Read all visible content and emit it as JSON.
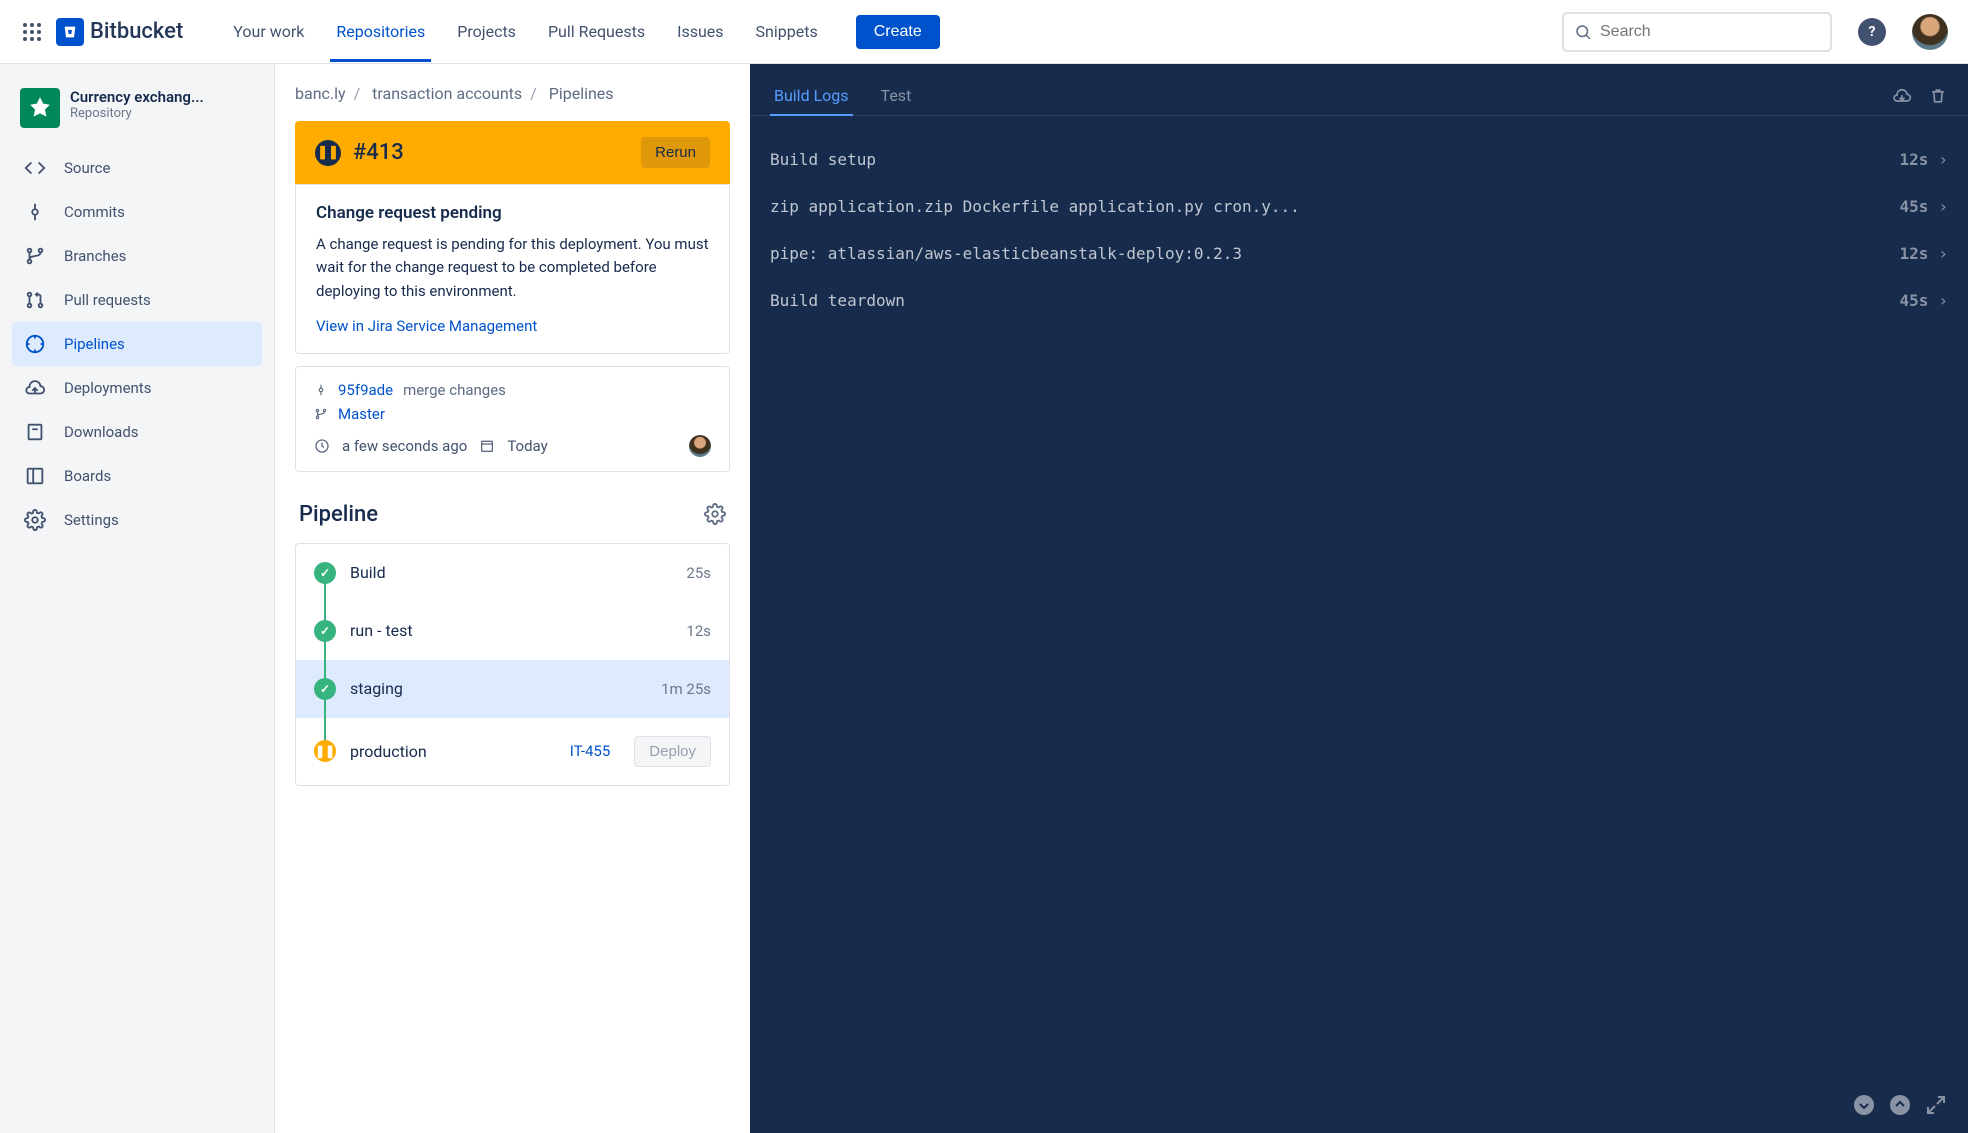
{
  "topbar": {
    "product": "Bitbucket",
    "links": [
      "Your work",
      "Repositories",
      "Projects",
      "Pull Requests",
      "Issues",
      "Snippets"
    ],
    "active_link_index": 1,
    "create": "Create",
    "search_placeholder": "Search"
  },
  "sidebar": {
    "repo_name": "Currency exchang...",
    "repo_sub": "Repository",
    "items": [
      {
        "label": "Source"
      },
      {
        "label": "Commits"
      },
      {
        "label": "Branches"
      },
      {
        "label": "Pull requests"
      },
      {
        "label": "Pipelines"
      },
      {
        "label": "Deployments"
      },
      {
        "label": "Downloads"
      },
      {
        "label": "Boards"
      },
      {
        "label": "Settings"
      }
    ],
    "active_index": 4
  },
  "breadcrumb": [
    "banc.ly",
    "transaction accounts",
    "Pipelines"
  ],
  "run": {
    "number": "#413",
    "rerun": "Rerun"
  },
  "notice": {
    "title": "Change request pending",
    "body": "A change request is pending for this deployment. You must wait for the change request to be completed before deploying to this environment.",
    "link": "View in Jira Service Management"
  },
  "commit": {
    "hash": "95f9ade",
    "message": "merge changes",
    "branch": "Master",
    "age": "a few seconds ago",
    "date": "Today"
  },
  "pipeline": {
    "title": "Pipeline",
    "stages": [
      {
        "name": "Build",
        "time": "25s",
        "status": "ok"
      },
      {
        "name": "run - test",
        "time": "12s",
        "status": "ok"
      },
      {
        "name": "staging",
        "time": "1m 25s",
        "status": "ok",
        "selected": true
      },
      {
        "name": "production",
        "status": "pause",
        "issue": "IT-455",
        "deploy": "Deploy"
      }
    ]
  },
  "logs": {
    "tabs": [
      "Build Logs",
      "Test"
    ],
    "active_tab": 0,
    "lines": [
      {
        "text": "Build setup",
        "time": "12s"
      },
      {
        "text": "zip application.zip Dockerfile application.py cron.y...",
        "time": "45s"
      },
      {
        "text": "pipe: atlassian/aws-elasticbeanstalk-deploy:0.2.3",
        "time": "12s"
      },
      {
        "text": "Build teardown",
        "time": "45s"
      }
    ]
  }
}
